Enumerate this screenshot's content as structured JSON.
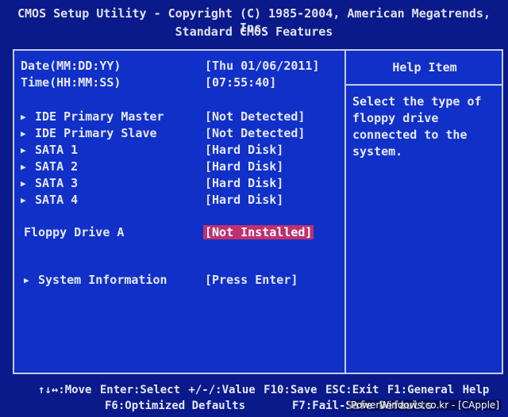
{
  "header": {
    "title": "CMOS Setup Utility - Copyright (C) 1985-2004, American Megatrends, Inc.",
    "subtitle": "Standard CMOS Features"
  },
  "help": {
    "title": "Help Item",
    "text": "Select the type of\nfloppy drive\nconnected to the\nsystem."
  },
  "settings": [
    {
      "label": "Date(MM:DD:YY)",
      "value": "[Thu 01/06/2011]"
    },
    {
      "label": "Time(HH:MM:SS)",
      "value": "[07:55:40]"
    },
    {
      "label": "IDE Primary Master",
      "value": "[Not Detected]"
    },
    {
      "label": "IDE Primary Slave",
      "value": "[Not Detected]"
    },
    {
      "label": "SATA 1",
      "value": "[Hard Disk]"
    },
    {
      "label": "SATA 2",
      "value": "[Hard Disk]"
    },
    {
      "label": "SATA 3",
      "value": "[Hard Disk]"
    },
    {
      "label": "SATA 4",
      "value": "[Hard Disk]"
    },
    {
      "label": "Floppy Drive A",
      "value": "[Not Installed]"
    },
    {
      "label": "System Information",
      "value": "[Press Enter]"
    }
  ],
  "icons": {
    "submenu_arrow": "triangle-right-icon"
  },
  "footer": {
    "line1": "↑↓↔:Move  Enter:Select  +/-/:Value  F10:Save  ESC:Exit  F1:General Help",
    "optimized": "F6:Optimized Defaults",
    "failsafe": "F7:Fail-Safe Defaults"
  },
  "watermark": "PowerWindows.co.kr - [CApple]",
  "colors": {
    "background": "#1030c8",
    "highlight": "#c0306e",
    "text": "#e6e8f5"
  }
}
